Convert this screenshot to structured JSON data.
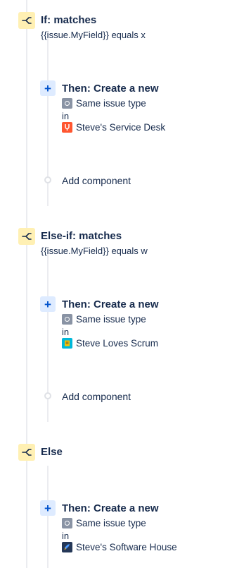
{
  "branches": [
    {
      "title": "If: matches",
      "condition": "{{issue.MyField}} equals x",
      "action": {
        "title": "Then: Create a new",
        "issue_type": "Same issue type",
        "in_label": "in",
        "project": "Steve's Service Desk",
        "project_icon": "service-desk-project-icon",
        "project_color": "#FF5630"
      },
      "add_component": "Add component"
    },
    {
      "title": "Else-if: matches",
      "condition": "{{issue.MyField}} equals w",
      "action": {
        "title": "Then: Create a new",
        "issue_type": "Same issue type",
        "in_label": "in",
        "project": "Steve Loves Scrum",
        "project_icon": "scrum-project-icon",
        "project_color": "#00B8D9"
      },
      "add_component": "Add component"
    },
    {
      "title": "Else",
      "action": {
        "title": "Then: Create a new",
        "issue_type": "Same issue type",
        "in_label": "in",
        "project": "Steve's Software House",
        "project_icon": "rocket-project-icon",
        "project_color": "#0065FF"
      }
    }
  ],
  "colors": {
    "condition_badge": "#FFF0B3",
    "action_badge": "#DEEBFF",
    "text": "#172B4D",
    "rail": "#EBECF0"
  }
}
